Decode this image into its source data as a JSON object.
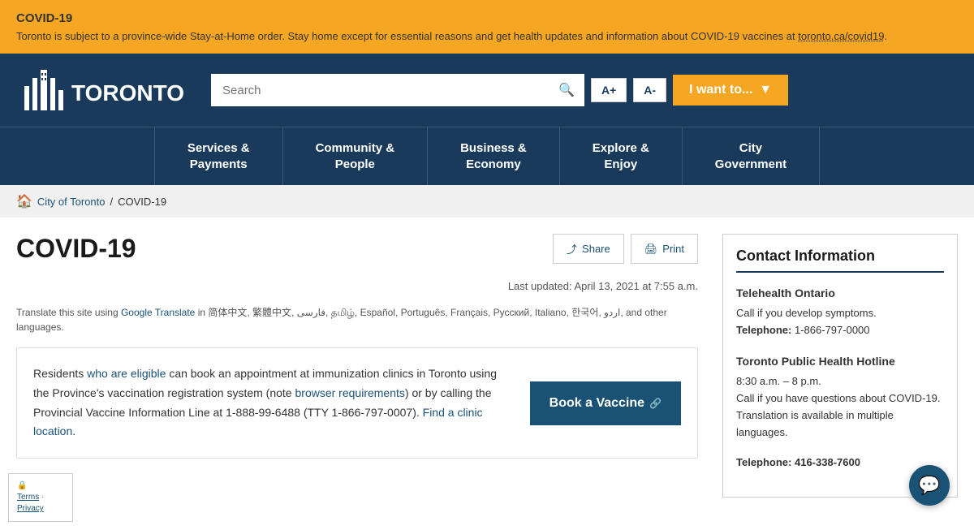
{
  "alert": {
    "title": "COVID-19",
    "text": "Toronto is subject to a province-wide Stay-at-Home order. Stay home except for essential reasons and get health updates and information about COVID-19 vaccines at ",
    "link_text": "toronto.ca/covid19",
    "link_url": "#"
  },
  "header": {
    "search_placeholder": "Search",
    "font_increase": "A+",
    "font_decrease": "A-",
    "i_want_label": "I want to...",
    "search_icon": "🔍"
  },
  "nav": {
    "items": [
      {
        "label": "Services &\nPayments"
      },
      {
        "label": "Community &\nPeople"
      },
      {
        "label": "Business &\nEconomy"
      },
      {
        "label": "Explore &\nEnjoy"
      },
      {
        "label": "City\nGovernment"
      }
    ]
  },
  "breadcrumb": {
    "home_label": "City of Toronto",
    "separator": "/",
    "current": "COVID-19"
  },
  "page": {
    "title": "COVID-19",
    "share_label": "Share",
    "print_label": "Print",
    "last_updated": "Last updated: April 13, 2021 at 7:55 a.m.",
    "translate_text": "Translate this site using",
    "translate_link": "Google Translate",
    "translate_suffix": "in 简体中文, 繁體中文, فارسی, தமிழ், Español, Português, Français, Русский, Italiano, 한국어, اردو, and other languages."
  },
  "vaccine_section": {
    "text_before_eligible": "Residents ",
    "eligible_link": "who are eligible",
    "text_middle": " can book an appointment at immunization clinics in Toronto using the Province's vaccination registration system (note ",
    "browser_link": "browser requirements",
    "text_after_browser": ") or by calling the Provincial Vaccine Information Line at 1-888-",
    "text_continued": "99-6488 (TTY 1-866-797-0007). ",
    "clinic_link": "Find a clinic location",
    "text_end": ".",
    "book_btn": "Book a Vaccine"
  },
  "contact": {
    "title": "Contact Information",
    "sections": [
      {
        "title": "Telehealth Ontario",
        "lines": [
          "Call if you develop symptoms.",
          "Telephone: 1-866-797-0000"
        ]
      },
      {
        "title": "Toronto Public Health Hotline",
        "lines": [
          "8:30 a.m. – 8 p.m.",
          "Call if you have questions about COVID-19. Translation is available in multiple languages."
        ]
      },
      {
        "title": "Telephone: 416-338-7600",
        "lines": []
      }
    ]
  },
  "cookie": {
    "text": "🔒",
    "terms_link": "Terms",
    "privacy_link": "Privacy"
  }
}
